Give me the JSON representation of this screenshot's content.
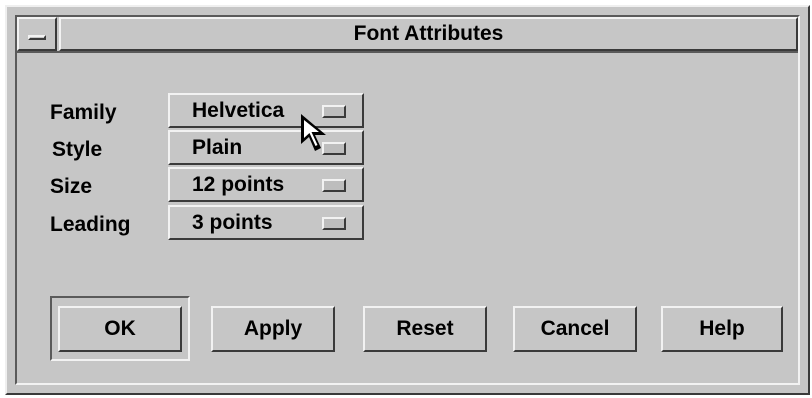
{
  "window": {
    "title": "Font Attributes"
  },
  "fields": [
    {
      "label": "Family",
      "value": "Helvetica"
    },
    {
      "label": "Style",
      "value": "Plain"
    },
    {
      "label": "Size",
      "value": "12 points"
    },
    {
      "label": "Leading",
      "value": "3 points"
    }
  ],
  "buttons": {
    "ok": "OK",
    "apply": "Apply",
    "reset": "Reset",
    "cancel": "Cancel",
    "help": "Help"
  },
  "icons": {
    "window_menu": "window-menu-icon",
    "option_indicator": "option-menu-indicator-icon",
    "cursor": "mouse-pointer-icon"
  },
  "colors": {
    "background": "#c6c6c6",
    "highlight": "#f2f2f2",
    "shadow": "#3a3a3a"
  }
}
